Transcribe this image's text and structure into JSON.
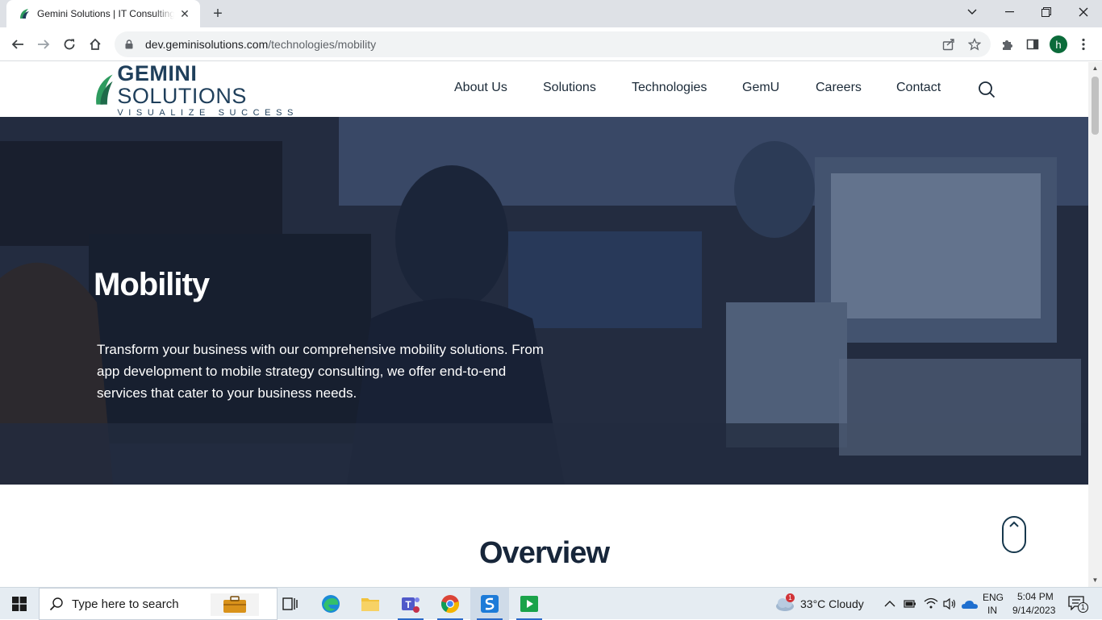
{
  "browser": {
    "tab_title": "Gemini Solutions | IT Consulting, ",
    "url_domain": "dev.geminisolutions.com",
    "url_path": "/technologies/mobility",
    "profile_initial": "h"
  },
  "site": {
    "logo_main_bold": "GEMINI",
    "logo_main_light": " SOLUTIONS",
    "logo_tagline": "VISUALIZE SUCCESS",
    "nav": [
      "About Us",
      "Solutions",
      "Technologies",
      "GemU",
      "Careers",
      "Contact"
    ]
  },
  "hero": {
    "title": "Mobility",
    "text": "Transform your business with our comprehensive mobility solutions. From app development to mobile strategy consulting, we offer end-to-end services that cater to your business needs."
  },
  "overview": {
    "heading": "Overview"
  },
  "taskbar": {
    "search_placeholder": "Type here to search",
    "weather": "33°C  Cloudy",
    "weather_badge": "1",
    "lang_top": "ENG",
    "lang_bottom": "IN",
    "time": "5:04 PM",
    "date": "9/14/2023",
    "notification_count": "1"
  },
  "colors": {
    "brand_navy": "#1f3f5b",
    "logo_green": "#2e9b5f",
    "chrome_tabstrip": "#dee1e6",
    "taskbar": "#e5ecf2"
  }
}
